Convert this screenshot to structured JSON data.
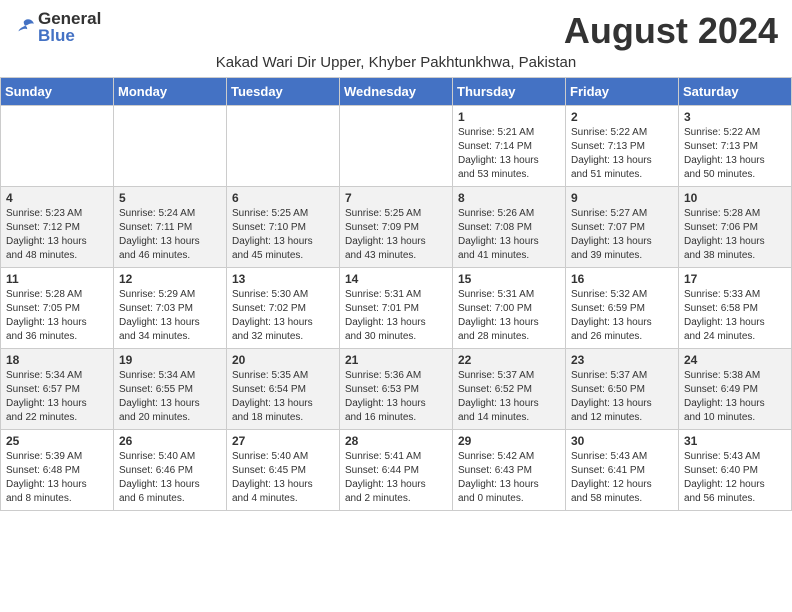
{
  "header": {
    "logo_general": "General",
    "logo_blue": "Blue",
    "month_title": "August 2024",
    "location": "Kakad Wari Dir Upper, Khyber Pakhtunkhwa, Pakistan"
  },
  "days_of_week": [
    "Sunday",
    "Monday",
    "Tuesday",
    "Wednesday",
    "Thursday",
    "Friday",
    "Saturday"
  ],
  "weeks": [
    {
      "days": [
        {
          "num": "",
          "info": ""
        },
        {
          "num": "",
          "info": ""
        },
        {
          "num": "",
          "info": ""
        },
        {
          "num": "",
          "info": ""
        },
        {
          "num": "1",
          "info": "Sunrise: 5:21 AM\nSunset: 7:14 PM\nDaylight: 13 hours\nand 53 minutes."
        },
        {
          "num": "2",
          "info": "Sunrise: 5:22 AM\nSunset: 7:13 PM\nDaylight: 13 hours\nand 51 minutes."
        },
        {
          "num": "3",
          "info": "Sunrise: 5:22 AM\nSunset: 7:13 PM\nDaylight: 13 hours\nand 50 minutes."
        }
      ]
    },
    {
      "days": [
        {
          "num": "4",
          "info": "Sunrise: 5:23 AM\nSunset: 7:12 PM\nDaylight: 13 hours\nand 48 minutes."
        },
        {
          "num": "5",
          "info": "Sunrise: 5:24 AM\nSunset: 7:11 PM\nDaylight: 13 hours\nand 46 minutes."
        },
        {
          "num": "6",
          "info": "Sunrise: 5:25 AM\nSunset: 7:10 PM\nDaylight: 13 hours\nand 45 minutes."
        },
        {
          "num": "7",
          "info": "Sunrise: 5:25 AM\nSunset: 7:09 PM\nDaylight: 13 hours\nand 43 minutes."
        },
        {
          "num": "8",
          "info": "Sunrise: 5:26 AM\nSunset: 7:08 PM\nDaylight: 13 hours\nand 41 minutes."
        },
        {
          "num": "9",
          "info": "Sunrise: 5:27 AM\nSunset: 7:07 PM\nDaylight: 13 hours\nand 39 minutes."
        },
        {
          "num": "10",
          "info": "Sunrise: 5:28 AM\nSunset: 7:06 PM\nDaylight: 13 hours\nand 38 minutes."
        }
      ]
    },
    {
      "days": [
        {
          "num": "11",
          "info": "Sunrise: 5:28 AM\nSunset: 7:05 PM\nDaylight: 13 hours\nand 36 minutes."
        },
        {
          "num": "12",
          "info": "Sunrise: 5:29 AM\nSunset: 7:03 PM\nDaylight: 13 hours\nand 34 minutes."
        },
        {
          "num": "13",
          "info": "Sunrise: 5:30 AM\nSunset: 7:02 PM\nDaylight: 13 hours\nand 32 minutes."
        },
        {
          "num": "14",
          "info": "Sunrise: 5:31 AM\nSunset: 7:01 PM\nDaylight: 13 hours\nand 30 minutes."
        },
        {
          "num": "15",
          "info": "Sunrise: 5:31 AM\nSunset: 7:00 PM\nDaylight: 13 hours\nand 28 minutes."
        },
        {
          "num": "16",
          "info": "Sunrise: 5:32 AM\nSunset: 6:59 PM\nDaylight: 13 hours\nand 26 minutes."
        },
        {
          "num": "17",
          "info": "Sunrise: 5:33 AM\nSunset: 6:58 PM\nDaylight: 13 hours\nand 24 minutes."
        }
      ]
    },
    {
      "days": [
        {
          "num": "18",
          "info": "Sunrise: 5:34 AM\nSunset: 6:57 PM\nDaylight: 13 hours\nand 22 minutes."
        },
        {
          "num": "19",
          "info": "Sunrise: 5:34 AM\nSunset: 6:55 PM\nDaylight: 13 hours\nand 20 minutes."
        },
        {
          "num": "20",
          "info": "Sunrise: 5:35 AM\nSunset: 6:54 PM\nDaylight: 13 hours\nand 18 minutes."
        },
        {
          "num": "21",
          "info": "Sunrise: 5:36 AM\nSunset: 6:53 PM\nDaylight: 13 hours\nand 16 minutes."
        },
        {
          "num": "22",
          "info": "Sunrise: 5:37 AM\nSunset: 6:52 PM\nDaylight: 13 hours\nand 14 minutes."
        },
        {
          "num": "23",
          "info": "Sunrise: 5:37 AM\nSunset: 6:50 PM\nDaylight: 13 hours\nand 12 minutes."
        },
        {
          "num": "24",
          "info": "Sunrise: 5:38 AM\nSunset: 6:49 PM\nDaylight: 13 hours\nand 10 minutes."
        }
      ]
    },
    {
      "days": [
        {
          "num": "25",
          "info": "Sunrise: 5:39 AM\nSunset: 6:48 PM\nDaylight: 13 hours\nand 8 minutes."
        },
        {
          "num": "26",
          "info": "Sunrise: 5:40 AM\nSunset: 6:46 PM\nDaylight: 13 hours\nand 6 minutes."
        },
        {
          "num": "27",
          "info": "Sunrise: 5:40 AM\nSunset: 6:45 PM\nDaylight: 13 hours\nand 4 minutes."
        },
        {
          "num": "28",
          "info": "Sunrise: 5:41 AM\nSunset: 6:44 PM\nDaylight: 13 hours\nand 2 minutes."
        },
        {
          "num": "29",
          "info": "Sunrise: 5:42 AM\nSunset: 6:43 PM\nDaylight: 13 hours\nand 0 minutes."
        },
        {
          "num": "30",
          "info": "Sunrise: 5:43 AM\nSunset: 6:41 PM\nDaylight: 12 hours\nand 58 minutes."
        },
        {
          "num": "31",
          "info": "Sunrise: 5:43 AM\nSunset: 6:40 PM\nDaylight: 12 hours\nand 56 minutes."
        }
      ]
    }
  ]
}
